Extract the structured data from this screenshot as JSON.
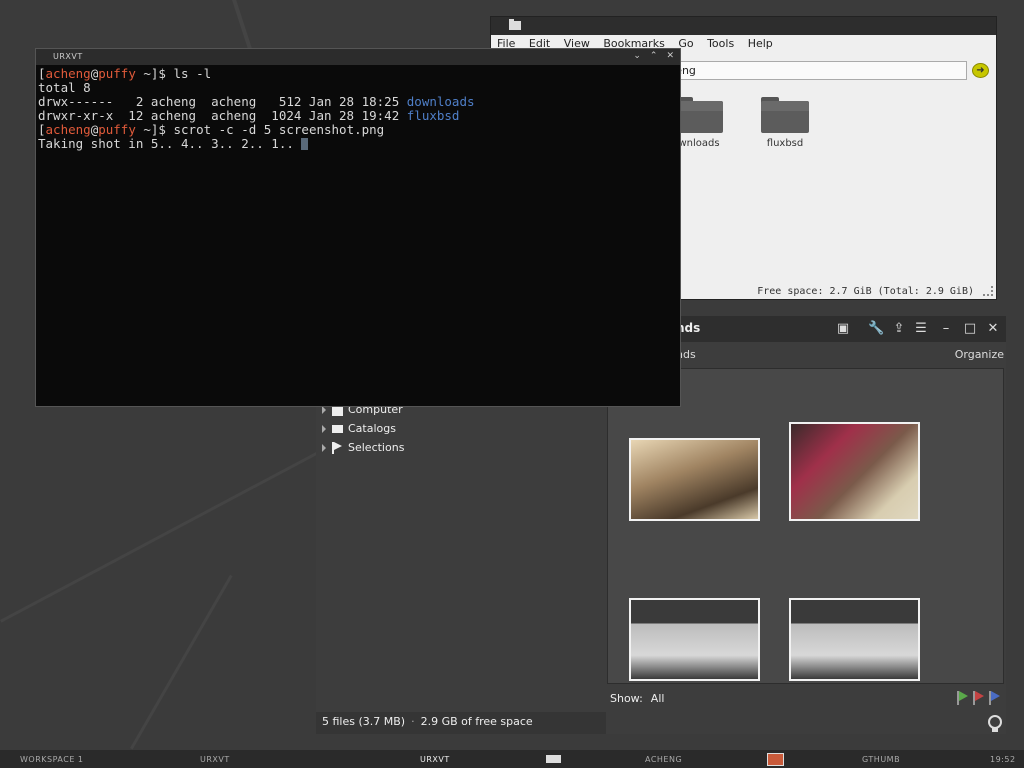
{
  "file_manager": {
    "menu": [
      "File",
      "Edit",
      "View",
      "Bookmarks",
      "Go",
      "Tools",
      "Help"
    ],
    "location": "/home/acheng",
    "location_visible": "s/acheng",
    "folders": [
      "downloads",
      "fluxbsd"
    ],
    "folder_labels_visible": [
      "wnloads",
      "fluxbsd"
    ],
    "status": "Free space: 2.7 GiB (Total: 2.9 GiB)"
  },
  "photo_manager": {
    "title": "nds",
    "subtitle": "nds",
    "organize_label": "Organize",
    "tree": [
      "Computer",
      "Catalogs",
      "Selections"
    ],
    "show_label": "Show:",
    "show_value": "All",
    "flag_colors": [
      "#5aa84a",
      "#c44343",
      "#4a6cc4"
    ],
    "status_files": "5 files (3.7 MB)",
    "status_free": "2.9 GB of free space"
  },
  "terminal": {
    "title": "URXVT",
    "lines": [
      {
        "segments": [
          {
            "t": "["
          },
          {
            "t": "acheng",
            "c": "red"
          },
          {
            "t": "@"
          },
          {
            "t": "puffy",
            "c": "red"
          },
          {
            "t": " ~]$ ls -l"
          }
        ]
      },
      {
        "segments": [
          {
            "t": "total 8"
          }
        ]
      },
      {
        "segments": [
          {
            "t": "drwx------   2 acheng  acheng   512 Jan 28 18:25 "
          },
          {
            "t": "downloads",
            "c": "blue"
          }
        ]
      },
      {
        "segments": [
          {
            "t": "drwxr-xr-x  12 acheng  acheng  1024 Jan 28 19:42 "
          },
          {
            "t": "fluxbsd",
            "c": "blue"
          }
        ]
      },
      {
        "segments": [
          {
            "t": "["
          },
          {
            "t": "acheng",
            "c": "red"
          },
          {
            "t": "@"
          },
          {
            "t": "puffy",
            "c": "red"
          },
          {
            "t": " ~]$ scrot -c -d 5 screenshot.png"
          }
        ]
      },
      {
        "segments": [
          {
            "t": "Taking shot in 5.. 4.. 3.. 2.. 1.. "
          }
        ],
        "cursor": true
      }
    ]
  },
  "taskbar": {
    "workspace": "WORKSPACE 1",
    "items": [
      "URXVT",
      "URXVT",
      "ACHENG",
      "GTHUMB"
    ],
    "clock": "19:52"
  }
}
